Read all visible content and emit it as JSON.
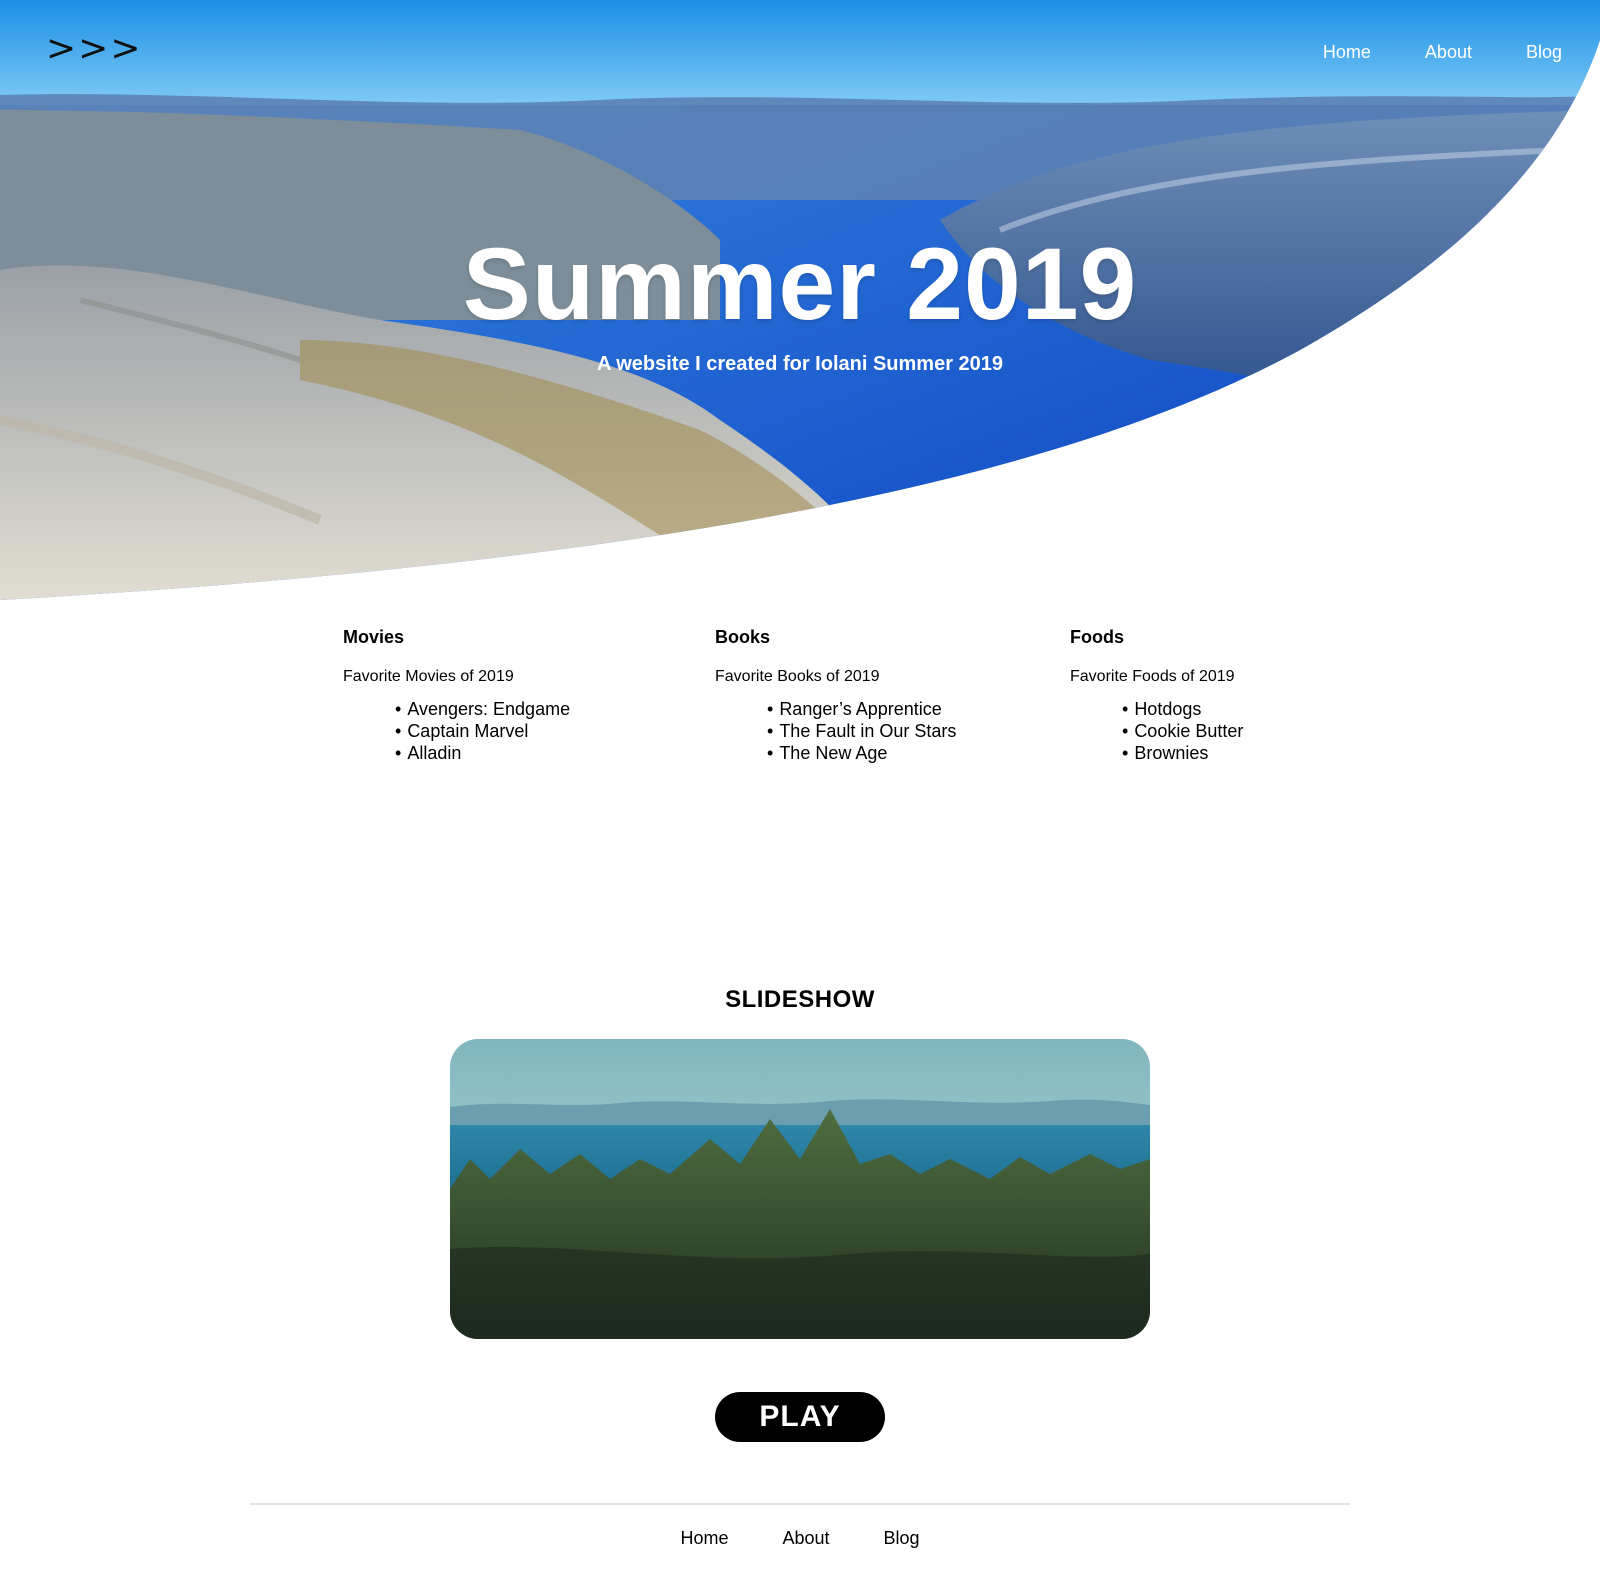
{
  "header": {
    "logo_text": ">>>",
    "nav": [
      {
        "label": "Home"
      },
      {
        "label": "About"
      },
      {
        "label": "Blog"
      }
    ]
  },
  "hero": {
    "title": "Summer 2019",
    "subtitle": "A website I created for Iolani Summer 2019",
    "colors": {
      "sky": "#1e9be8",
      "water": "#1a5fd0",
      "rock": "#c9c9c2"
    }
  },
  "columns": [
    {
      "heading": "Movies",
      "subheading": "Favorite Movies of 2019",
      "items": [
        "Avengers: Endgame",
        "Captain Marvel",
        "Alladin"
      ]
    },
    {
      "heading": "Books",
      "subheading": "Favorite Books of 2019",
      "items": [
        "Ranger’s Apprentice",
        "The Fault in Our Stars",
        "The New Age"
      ]
    },
    {
      "heading": "Foods",
      "subheading": "Favorite Foods of 2019",
      "items": [
        "Hotdogs",
        "Cookie Butter",
        "Brownies"
      ]
    }
  ],
  "slideshow": {
    "title": "SLIDESHOW",
    "play_label": "PLAY"
  },
  "footer": {
    "nav": [
      {
        "label": "Home"
      },
      {
        "label": "About"
      },
      {
        "label": "Blog"
      }
    ]
  }
}
